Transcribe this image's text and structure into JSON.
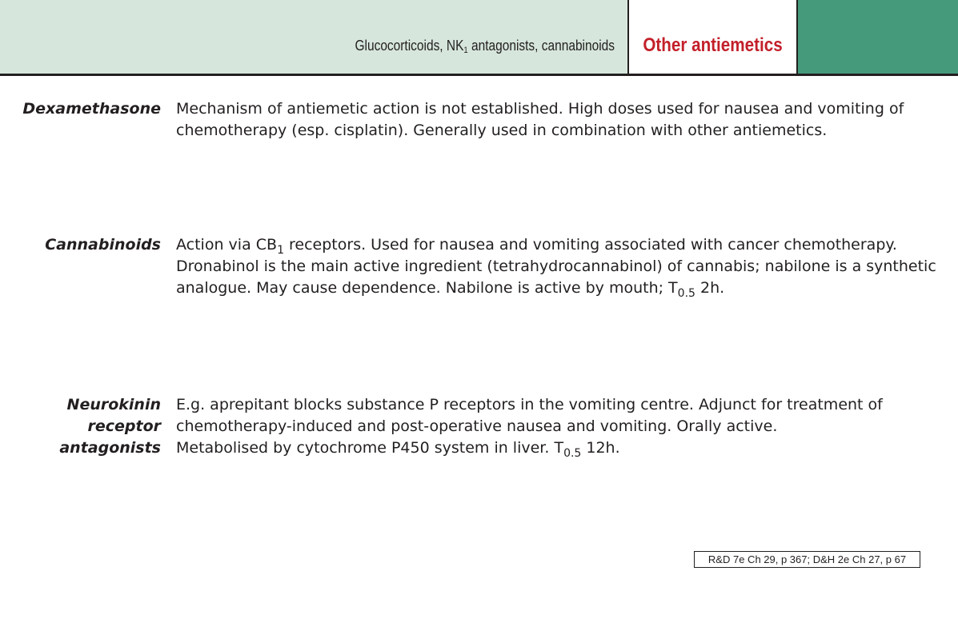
{
  "header": {
    "subtitle_prefix": "Glucocorticoids, NK",
    "subtitle_sub": "1",
    "subtitle_suffix": " antagonists, cannabinoids",
    "section_title": "Other antiemetics",
    "colors": {
      "band": "#d6e6dc",
      "accent": "#459a7c",
      "title": "#c3202a"
    }
  },
  "entries": [
    {
      "term_lines": [
        "Dexamethasone"
      ],
      "lines": [
        "Mechanism of antiemetic action is not established. High doses used for nausea and vomiting of",
        "chemotherapy (esp. cisplatin). Generally used in combination with other antiemetics."
      ]
    },
    {
      "term_lines": [
        "Cannabinoids"
      ],
      "line1_pre": "Action via CB",
      "line1_sub": "1",
      "line1_post": " receptors. Used for nausea and vomiting associated with cancer chemotherapy.",
      "line2": "Dronabinol is the main active ingredient (tetrahydrocannabinol) of cannabis; nabilone is a synthetic",
      "line3_pre": "analogue. May cause dependence. Nabilone is  active by mouth; T",
      "line3_sub": "0.5",
      "line3_post": " 2h."
    },
    {
      "term_lines": [
        "Neurokinin",
        "receptor",
        "antagonists"
      ],
      "line1": "E.g. aprepitant blocks substance P receptors in the vomiting centre. Adjunct for treatment of",
      "line2": "chemotherapy-induced  and post-operative nausea and vomiting. Orally active.",
      "line3_pre": "Metabolised by cytochrome P450 system in liver. T",
      "line3_sub": "0.5",
      "line3_post": " 12h."
    }
  ],
  "reference": "R&D 7e Ch 29, p 367; D&H 2e Ch 27, p 67"
}
